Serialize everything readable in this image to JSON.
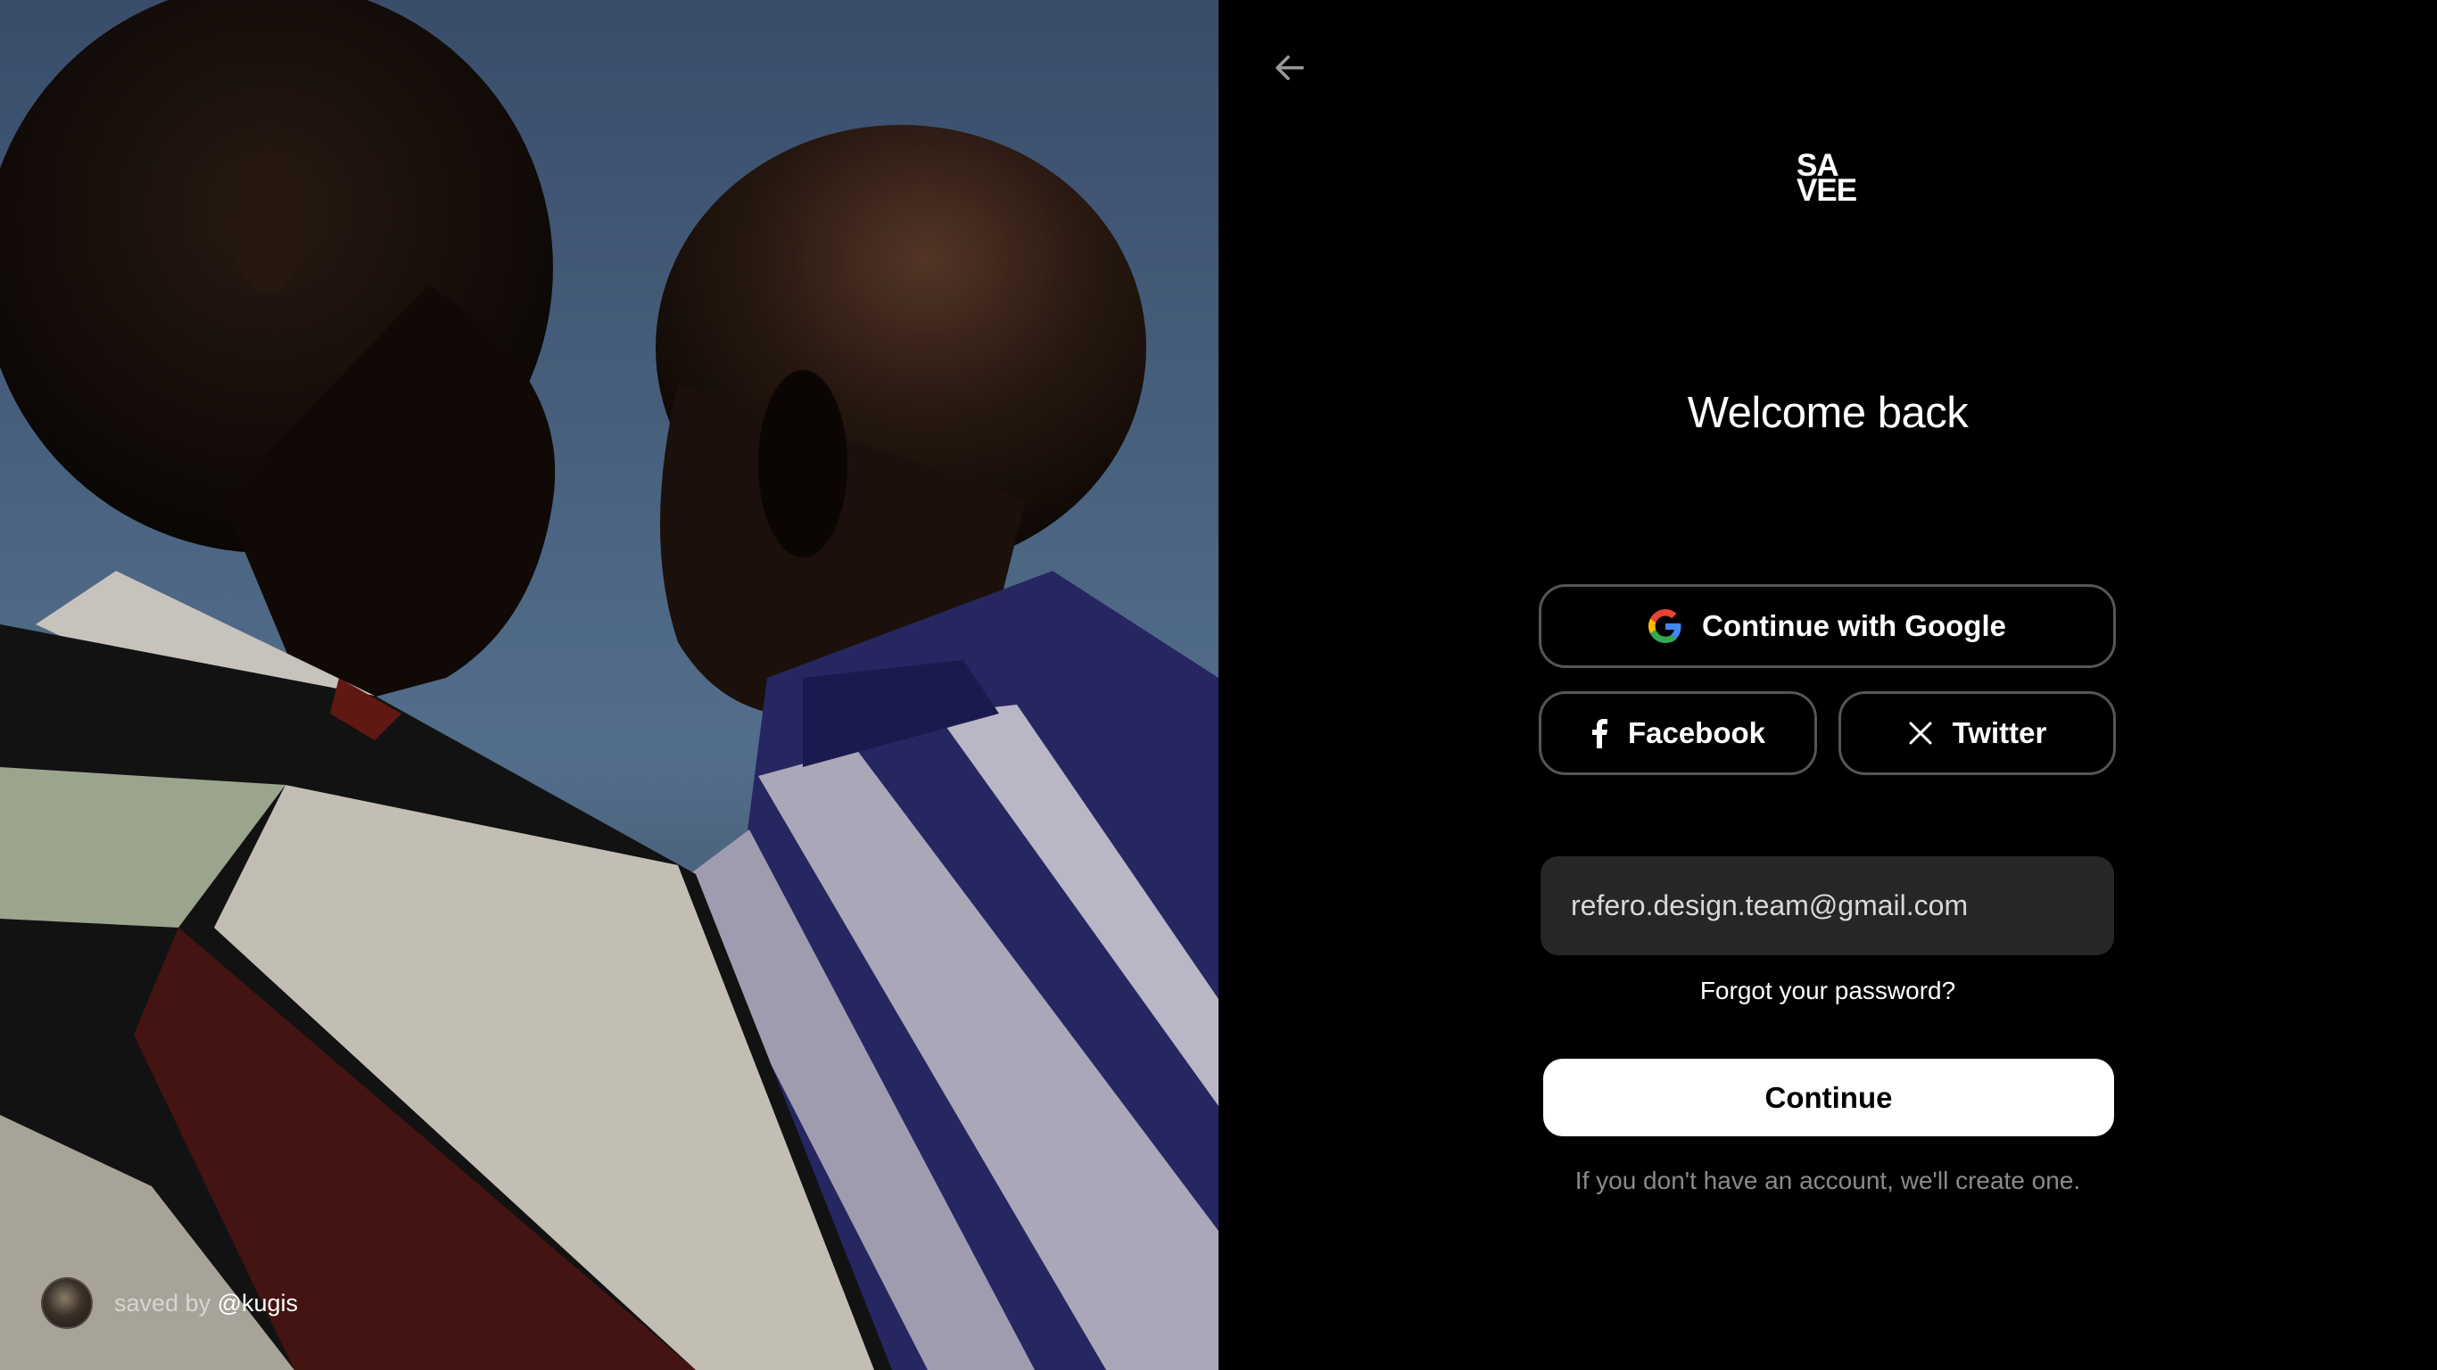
{
  "hero": {
    "credit_prefix": "saved by",
    "credit_user": "@kugis"
  },
  "panel": {
    "back_icon": "arrow-left-icon",
    "logo": "SA\nVEE",
    "title": "Welcome back",
    "google_label": "Continue with Google",
    "facebook_label": "Facebook",
    "twitter_label": "Twitter",
    "email_value": "refero.design.team@gmail.com",
    "forgot_label": "Forgot your password?",
    "continue_label": "Continue",
    "note": "If you don't have an account, we'll create one."
  },
  "colors": {
    "background": "#000000",
    "button_border": "#555555",
    "field_bg": "#262626",
    "continue_bg": "#ffffff",
    "muted_text": "#8a8a8a"
  }
}
